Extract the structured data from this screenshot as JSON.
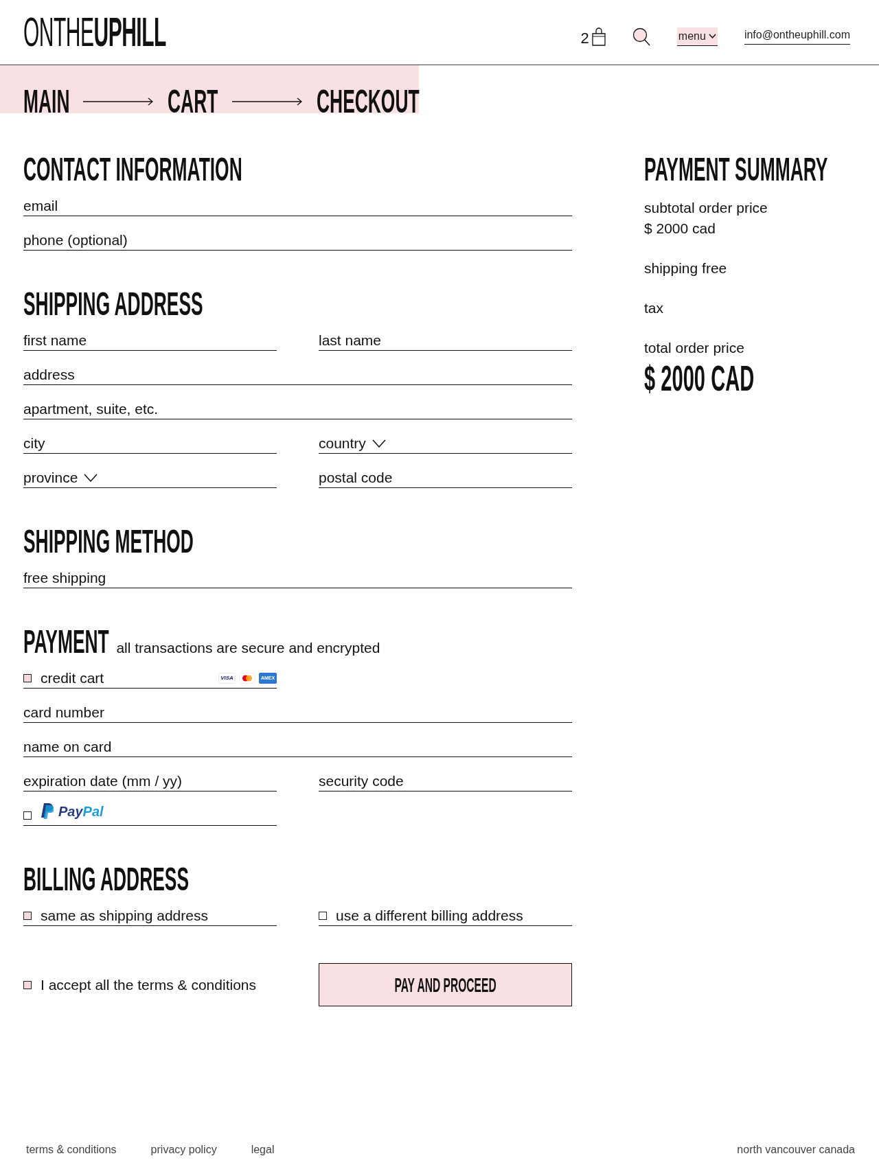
{
  "header": {
    "logo": "ONTHE**UPHILL**",
    "cart_count": "2",
    "menu_label": "menu",
    "email": "info@ontheuphill.com"
  },
  "breadcrumb": [
    {
      "label": "MAIN"
    },
    {
      "label": "CART"
    },
    {
      "label": "CHECKOUT"
    }
  ],
  "sections": [
    {
      "title": "CONTACT INFORMATION",
      "rows": [
        [
          {
            "kind": "input",
            "placeholder": "email"
          }
        ],
        [
          {
            "kind": "input",
            "placeholder": "phone (optional)"
          }
        ]
      ]
    },
    {
      "title": "SHIPPING ADDRESS",
      "rows": [
        [
          {
            "kind": "input",
            "placeholder": "first name"
          },
          {
            "kind": "input",
            "placeholder": "last name"
          }
        ],
        [
          {
            "kind": "input",
            "placeholder": "address"
          }
        ],
        [
          {
            "kind": "input",
            "placeholder": "apartment, suite, etc."
          }
        ],
        [
          {
            "kind": "input",
            "placeholder": "city"
          },
          {
            "kind": "select",
            "label": "country"
          }
        ],
        [
          {
            "kind": "select",
            "label": "province"
          },
          {
            "kind": "input",
            "placeholder": "postal code"
          }
        ]
      ]
    },
    {
      "title": "SHIPPING METHOD",
      "rows": [
        [
          {
            "kind": "input",
            "value": "free shipping"
          }
        ]
      ]
    },
    {
      "title": "PAYMENT",
      "subtitle": "all transactions are secure and encrypted",
      "rows": [
        [
          {
            "kind": "option",
            "label": "credit cart",
            "checked": true,
            "logos": [
              {
                "kind": "visa",
                "text": "VISA"
              },
              {
                "kind": "mastercard"
              },
              {
                "kind": "amex",
                "text": "AMEX"
              }
            ]
          }
        ],
        [
          {
            "kind": "input",
            "placeholder": "card number"
          }
        ],
        [
          {
            "kind": "input",
            "placeholder": "name on card"
          }
        ],
        [
          {
            "kind": "input",
            "placeholder": "expiration date (mm / yy)"
          },
          {
            "kind": "input",
            "placeholder": "security code"
          }
        ],
        [
          {
            "kind": "option",
            "checked": false,
            "logos": [
              {
                "kind": "paypal",
                "text": "PayPal"
              }
            ]
          }
        ]
      ]
    },
    {
      "title": "BILLING ADDRESS",
      "rows": [
        [
          {
            "kind": "option",
            "label": "same as shipping address",
            "checked": true
          },
          {
            "kind": "option",
            "label": "use a different billing address",
            "checked": false
          }
        ]
      ]
    }
  ],
  "terms": {
    "label": "I accept all the terms & conditions",
    "checked": true
  },
  "submit": {
    "label": "PAY AND PROCEED"
  },
  "summary": {
    "title": "PAYMENT SUMMARY",
    "items": [
      {
        "label": "subtotal order price",
        "value": "$ 2000 cad"
      },
      {
        "label": "shipping free"
      },
      {
        "label": "tax"
      },
      {
        "label": "total order price",
        "total": "$ 2000 CAD"
      }
    ]
  },
  "footer": {
    "links": [
      "terms & conditions",
      "privacy policy",
      "legal"
    ],
    "location": "north vancouver canada"
  }
}
